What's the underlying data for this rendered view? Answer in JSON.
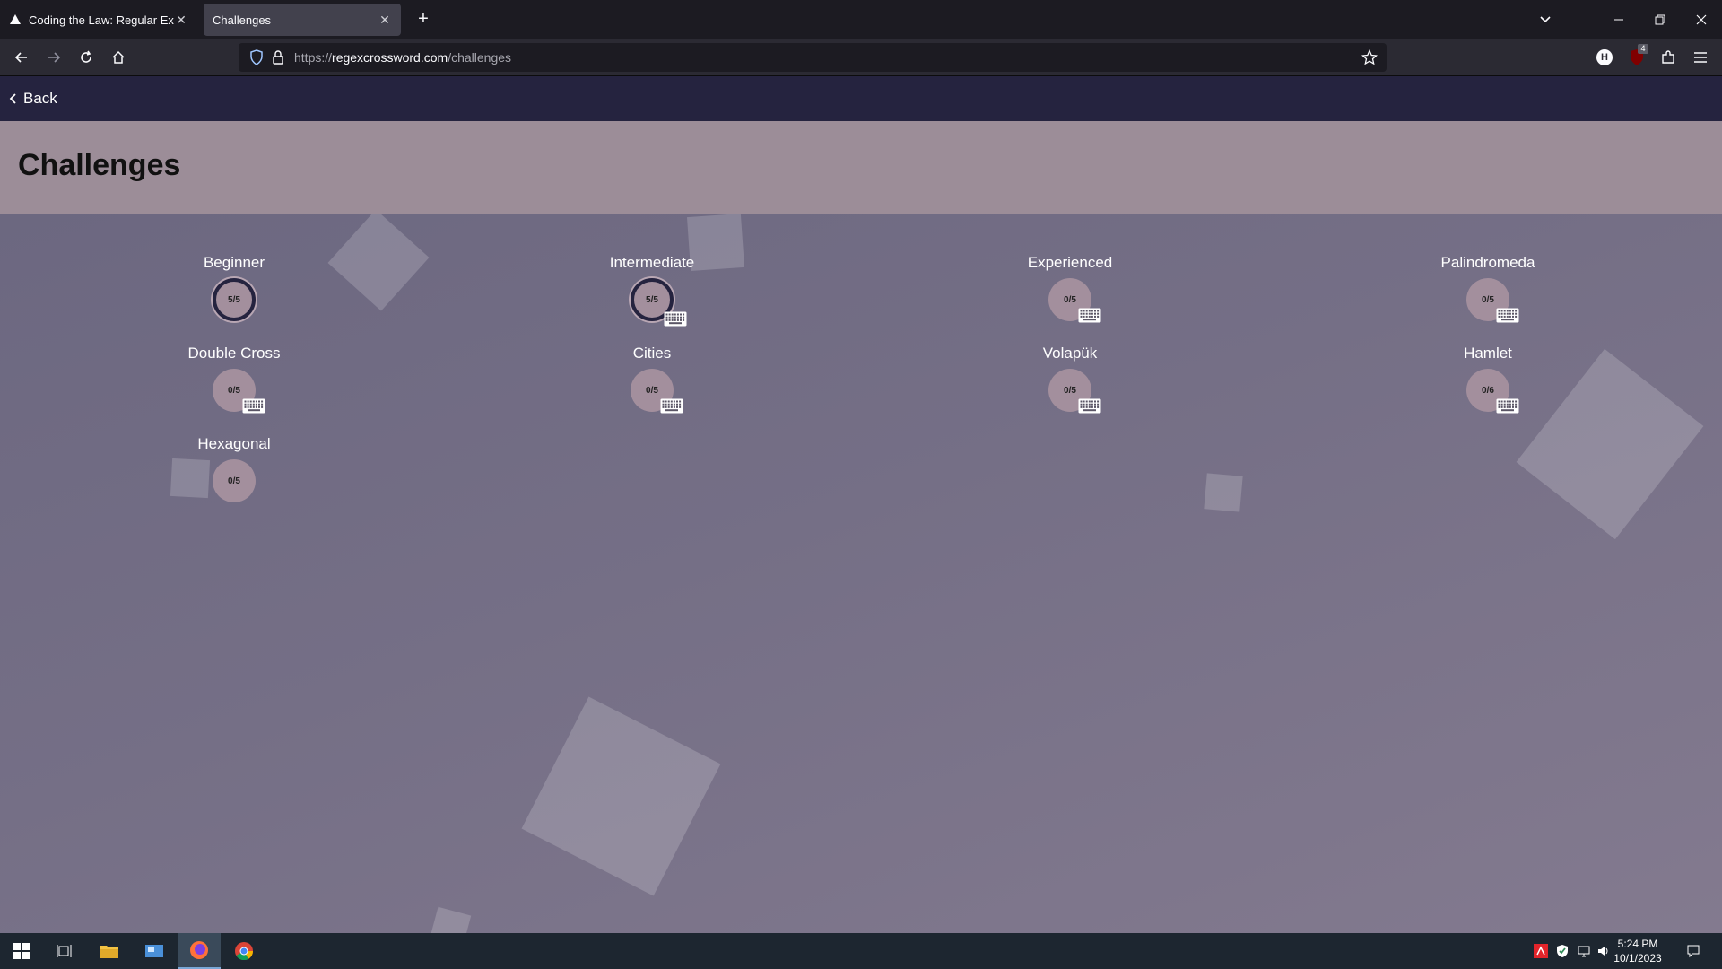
{
  "browser": {
    "tabs": [
      {
        "title": "Coding the Law: Regular Expres",
        "active": false
      },
      {
        "title": "Challenges",
        "active": true
      }
    ],
    "url": {
      "scheme": "https://",
      "host": "regexcrossword.com",
      "path": "/challenges"
    },
    "extension_badge": "4",
    "extension_h_label": "H"
  },
  "page": {
    "back_label": "Back",
    "title": "Challenges",
    "challenges": [
      {
        "name": "Beginner",
        "progress": "5/5",
        "completed": true,
        "keyboard_icon": false
      },
      {
        "name": "Intermediate",
        "progress": "5/5",
        "completed": true,
        "keyboard_icon": true
      },
      {
        "name": "Experienced",
        "progress": "0/5",
        "completed": false,
        "keyboard_icon": true
      },
      {
        "name": "Palindromeda",
        "progress": "0/5",
        "completed": false,
        "keyboard_icon": true
      },
      {
        "name": "Double Cross",
        "progress": "0/5",
        "completed": false,
        "keyboard_icon": true
      },
      {
        "name": "Cities",
        "progress": "0/5",
        "completed": false,
        "keyboard_icon": true
      },
      {
        "name": "Volapük",
        "progress": "0/5",
        "completed": false,
        "keyboard_icon": true
      },
      {
        "name": "Hamlet",
        "progress": "0/6",
        "completed": false,
        "keyboard_icon": true
      },
      {
        "name": "Hexagonal",
        "progress": "0/5",
        "completed": false,
        "keyboard_icon": false
      }
    ]
  },
  "taskbar": {
    "time": "5:24 PM",
    "date": "10/1/2023"
  }
}
